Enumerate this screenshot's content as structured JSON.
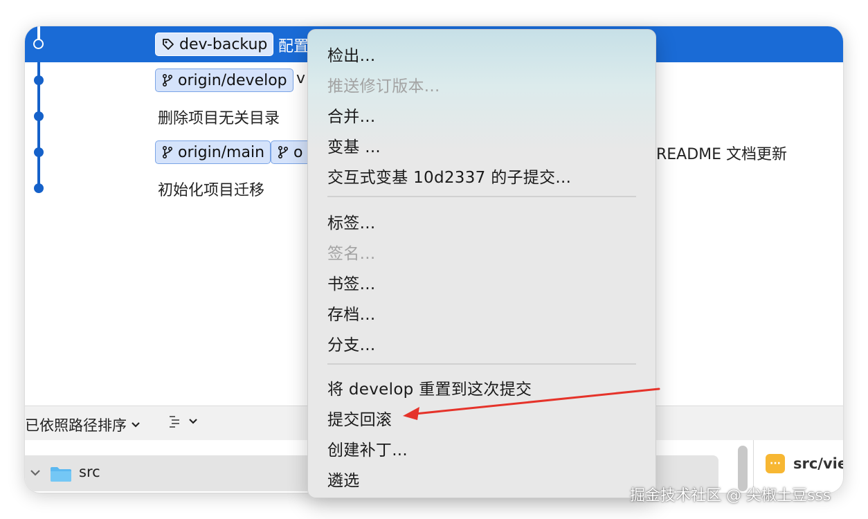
{
  "commits": [
    {
      "refs": [
        {
          "type": "tag",
          "label": "dev-backup"
        }
      ],
      "message": "配置"
    },
    {
      "refs": [
        {
          "type": "branch",
          "label": "origin/develop"
        }
      ],
      "message": "v"
    },
    {
      "refs": [],
      "message": "删除项目无关目录"
    },
    {
      "refs": [
        {
          "type": "branch",
          "label": "origin/main"
        },
        {
          "type": "branch",
          "label": "o"
        }
      ],
      "message": "README 文档更新"
    },
    {
      "refs": [],
      "message": "初始化项目迁移"
    }
  ],
  "toolbar": {
    "sort_label": "已依照路径排序",
    "list_icon": "list-indent-icon"
  },
  "file_tree": {
    "folder_name": "src",
    "right_file": "src/vie",
    "right_file_badge": "···"
  },
  "context_menu": {
    "group1": [
      {
        "label": "检出...",
        "enabled": true
      },
      {
        "label": "推送修订版本...",
        "enabled": false
      },
      {
        "label": "合并...",
        "enabled": true
      },
      {
        "label": "变基 ...",
        "enabled": true
      },
      {
        "label": "交互式变基 10d2337 的子提交...",
        "enabled": true
      }
    ],
    "group2": [
      {
        "label": "标签...",
        "enabled": true
      },
      {
        "label": "签名...",
        "enabled": false
      },
      {
        "label": "书签...",
        "enabled": true
      },
      {
        "label": "存档...",
        "enabled": true
      },
      {
        "label": "分支...",
        "enabled": true
      }
    ],
    "group3": [
      {
        "label": "将 develop 重置到这次提交",
        "enabled": true
      },
      {
        "label": "提交回滚",
        "enabled": true
      },
      {
        "label": "创建补丁...",
        "enabled": true
      },
      {
        "label": "遴选",
        "enabled": true
      }
    ]
  },
  "annotation": {
    "color": "#e5332a",
    "points_to": "提交回滚"
  },
  "watermark": "掘金技术社区 @ 尖椒土豆sss",
  "colors": {
    "selection": "#1a6bd6",
    "graph": "#1561c9",
    "tag_bg": "#d5e3fb"
  }
}
